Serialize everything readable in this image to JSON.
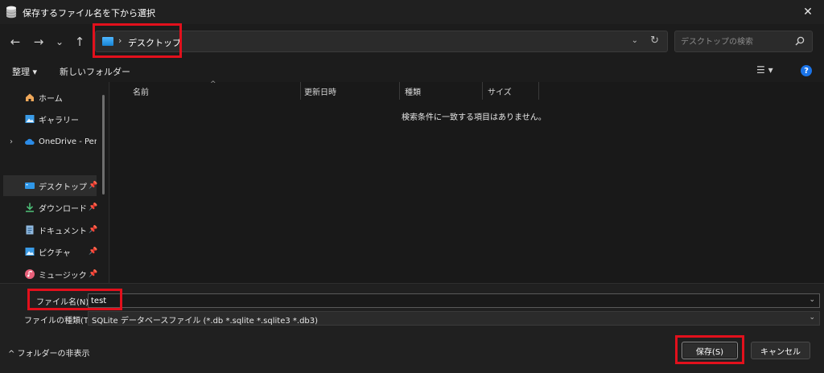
{
  "window": {
    "title": "保存するファイル名を下から選択",
    "close_glyph": "✕"
  },
  "nav": {
    "back": "←",
    "forward": "→",
    "recent": "⌄",
    "up": "↑",
    "address": "デスクトップ",
    "address_chevron": "›",
    "address_dropdown": "⌄",
    "refresh": "↻",
    "search_placeholder": "デスクトップの検索"
  },
  "commandbar": {
    "organize": "整理 ▾",
    "new_folder": "新しいフォルダー",
    "view": "☰ ▾",
    "help": "?"
  },
  "sidebar": {
    "items": [
      {
        "label": "ホーム",
        "icon": "home-icon",
        "chevron": ""
      },
      {
        "label": "ギャラリー",
        "icon": "gallery-icon",
        "chevron": ""
      },
      {
        "label": "OneDrive - Personal",
        "icon": "cloud-icon",
        "chevron": "›"
      },
      {
        "label": "デスクトップ",
        "icon": "desktop-icon",
        "chevron": ""
      },
      {
        "label": "ダウンロード",
        "icon": "download-icon",
        "chevron": ""
      },
      {
        "label": "ドキュメント",
        "icon": "document-icon",
        "chevron": ""
      },
      {
        "label": "ピクチャ",
        "icon": "pictures-icon",
        "chevron": ""
      },
      {
        "label": "ミュージック",
        "icon": "music-icon",
        "chevron": ""
      }
    ],
    "pin_glyph": "📌"
  },
  "filelist": {
    "columns": [
      "名前",
      "更新日時",
      "種類",
      "サイズ"
    ],
    "sort_arrow": "^",
    "empty_message": "検索条件に一致する項目はありません。"
  },
  "bottom": {
    "filename_label": "ファイル名(N):",
    "filename_value": "test",
    "filetype_label": "ファイルの種類(T):",
    "filetype_value": "SQLite データベースファイル (*.db *.sqlite *.sqlite3 *.db3)",
    "dropdown": "⌄",
    "hide_folders": "^ フォルダーの非表示",
    "save_label": "保存(S)",
    "cancel_label": "キャンセル"
  },
  "colors": {
    "annotation_red": "#e2101c",
    "accent_blue": "#1a73e8"
  }
}
